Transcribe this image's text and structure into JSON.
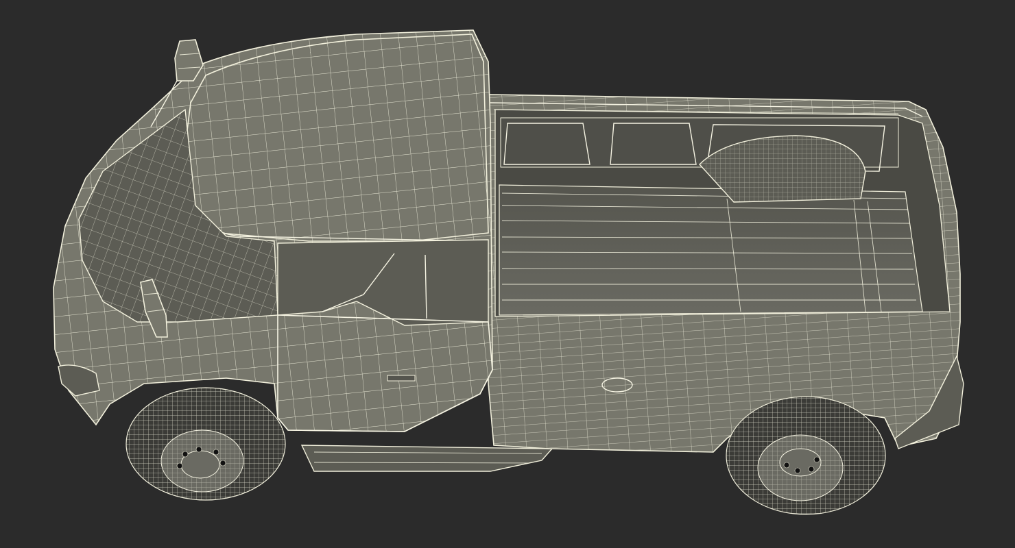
{
  "scene": {
    "subject": "",
    "colors": {
      "background": "#2b2b2b",
      "surface": "#77776c",
      "surface_shadow": "#4a4a44",
      "wireframe": "#f2f0dc"
    }
  }
}
